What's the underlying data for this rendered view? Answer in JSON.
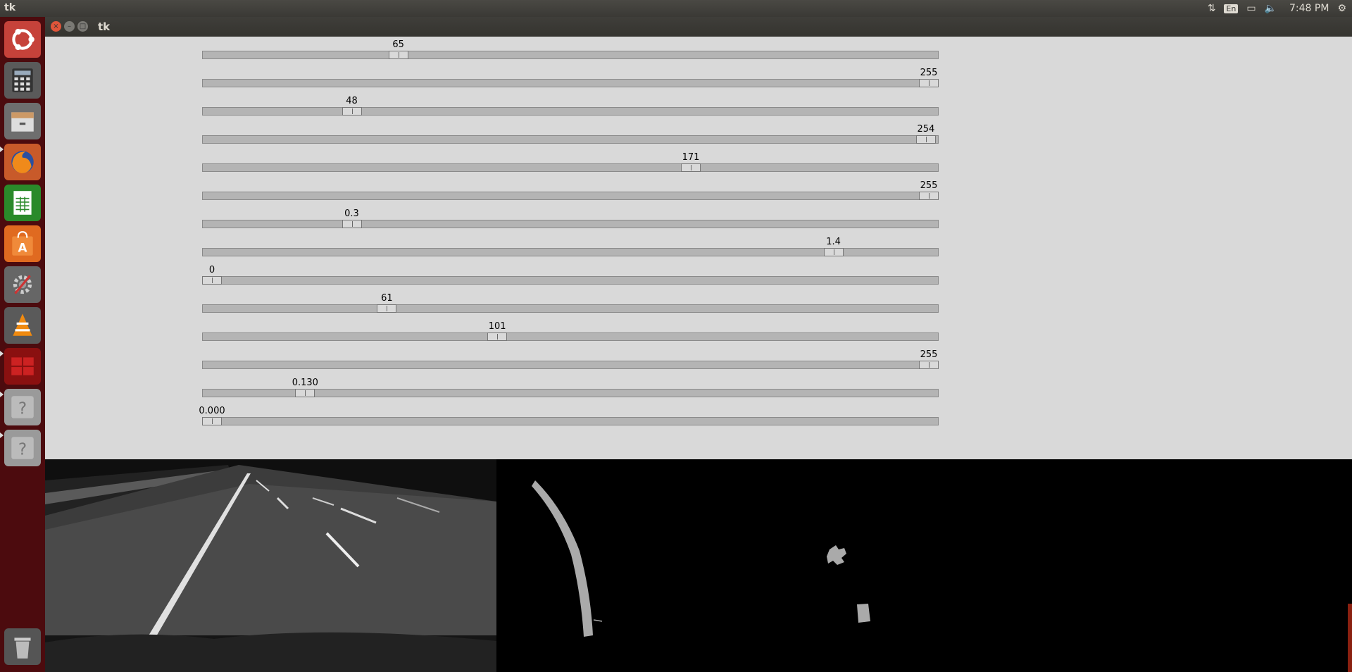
{
  "top_panel": {
    "app_name": "tk",
    "keyboard_layout": "En",
    "clock": "7:48 PM"
  },
  "launcher": {
    "items": [
      {
        "name": "ubuntu-dash-icon",
        "bg": "#c6423a"
      },
      {
        "name": "calculator-icon",
        "bg": "#5a5a5a"
      },
      {
        "name": "files-icon",
        "bg": "#6e6e6e"
      },
      {
        "name": "firefox-icon",
        "bg": "#c85a2a"
      },
      {
        "name": "spreadsheet-icon",
        "bg": "#2a8a2a"
      },
      {
        "name": "software-center-icon",
        "bg": "#e06a20"
      },
      {
        "name": "system-settings-icon",
        "bg": "#666"
      },
      {
        "name": "vlc-icon",
        "bg": "#e07a10"
      },
      {
        "name": "workspace-switcher-icon",
        "bg": "#8a1010"
      },
      {
        "name": "unknown-app-icon",
        "bg": "#9a9a9a"
      },
      {
        "name": "unknown-app-icon",
        "bg": "#9a9a9a"
      },
      {
        "name": "trash-icon",
        "bg": "#7a7a7a"
      }
    ]
  },
  "window": {
    "title": "tk"
  },
  "scales": [
    {
      "label": "65",
      "fraction": 0.26
    },
    {
      "label": "255",
      "fraction": 1.0
    },
    {
      "label": "48",
      "fraction": 0.195
    },
    {
      "label": "254",
      "fraction": 0.996
    },
    {
      "label": "171",
      "fraction": 0.668
    },
    {
      "label": "255",
      "fraction": 1.0
    },
    {
      "label": "0.3",
      "fraction": 0.195
    },
    {
      "label": "1.4",
      "fraction": 0.867
    },
    {
      "label": "0",
      "fraction": 0.0
    },
    {
      "label": "61",
      "fraction": 0.244
    },
    {
      "label": "101",
      "fraction": 0.398
    },
    {
      "label": "255",
      "fraction": 1.0
    },
    {
      "label": "0.130",
      "fraction": 0.13
    },
    {
      "label": "0.000",
      "fraction": 0.0
    }
  ]
}
